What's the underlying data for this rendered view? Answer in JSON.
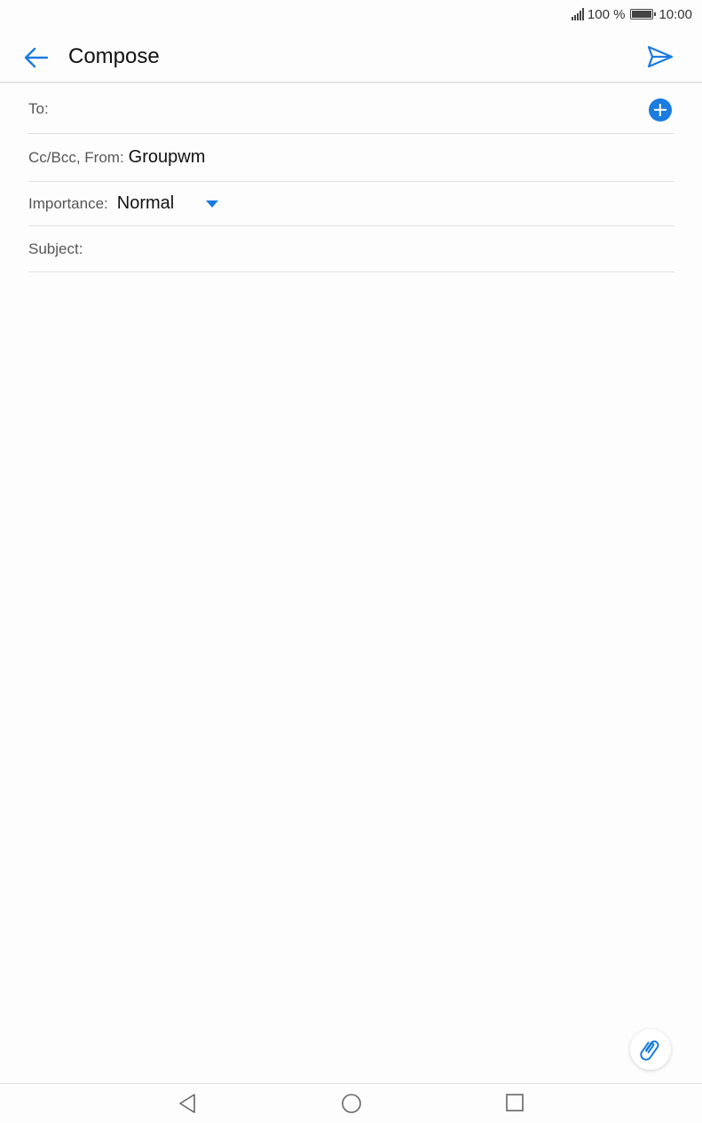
{
  "status_bar": {
    "battery_percent": "100 %",
    "time": "10:00"
  },
  "app_bar": {
    "title": "Compose",
    "back_icon": "arrow-left-icon",
    "send_icon": "send-icon"
  },
  "form": {
    "to_label": "To:",
    "to_value": "",
    "cc_label": "Cc/Bcc, From:",
    "cc_value": "Groupwm",
    "importance_label": "Importance:",
    "importance_value": "Normal",
    "subject_label": "Subject:",
    "subject_value": ""
  },
  "colors": {
    "accent": "#1a7be0",
    "background": "#fdfdfd",
    "divider": "#e2e2e2"
  },
  "icons": {
    "add_contact": "plus-circle-icon",
    "attachment": "paperclip-icon",
    "nav_back": "triangle-back-icon",
    "nav_home": "circle-home-icon",
    "nav_recents": "square-recents-icon"
  }
}
